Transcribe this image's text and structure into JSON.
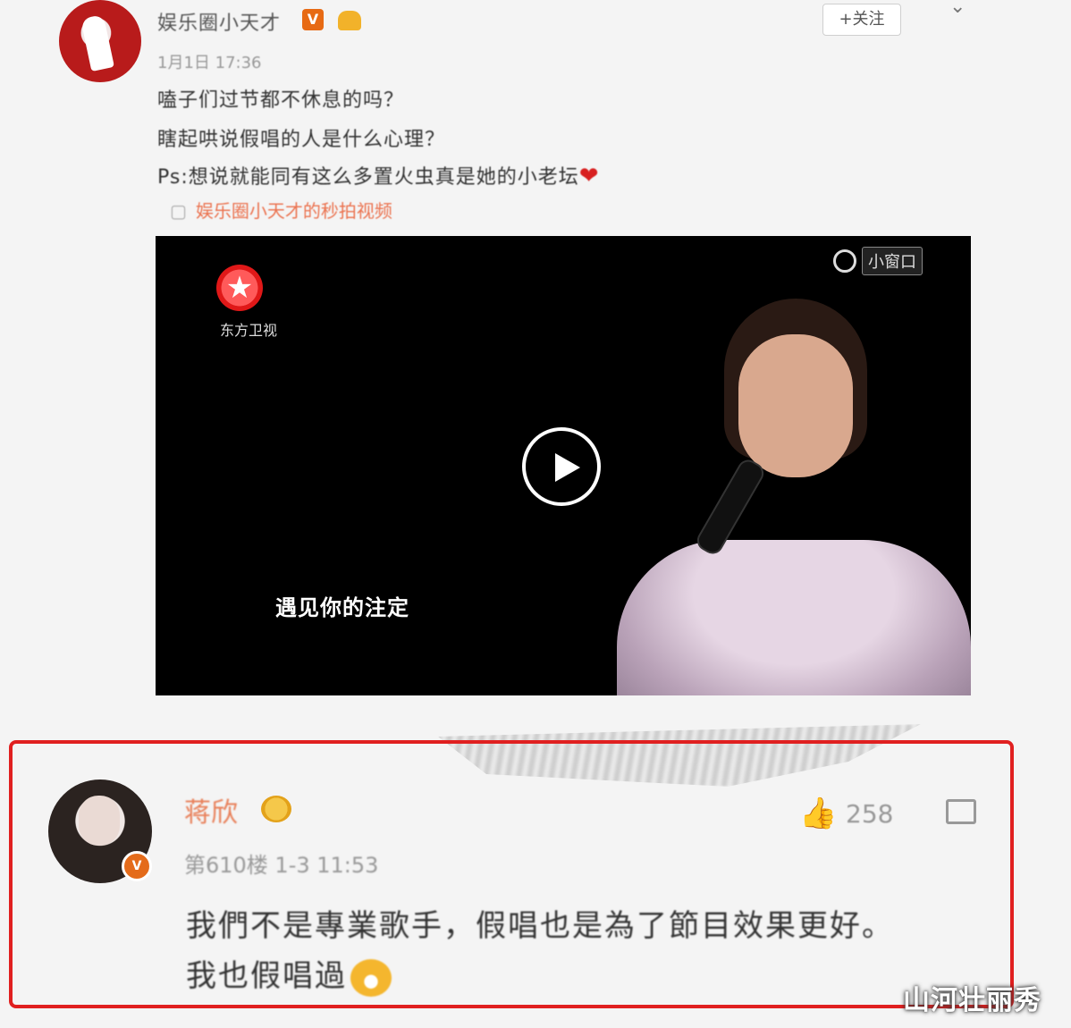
{
  "post": {
    "author": "娱乐圈小天才",
    "verified_badge": "V",
    "follow_label": "+关注",
    "chevron": "⌄",
    "time": "1月1日 17:36",
    "lines": [
      "嗑子们过节都不休息的吗？",
      "瞎起哄说假唱的人是什么心理？",
      "Ps:想说就能同有这么多置火虫真是她的小老坛"
    ],
    "heart": "❤",
    "link_icon": "▢",
    "link_text": "娱乐圈小天才的秒拍视频"
  },
  "video": {
    "channel_logo_glyph": "★",
    "channel_name": "东方卫视",
    "pip_label": "小窗口",
    "subtitle": "遇见你的注定"
  },
  "comment": {
    "name": "蒋欣",
    "vip_badge": "V",
    "like_icon": "👍",
    "likes": "258",
    "meta": "第610楼 1-3 11:53",
    "text_line1": "我們不是專業歌手，假唱也是為了節目效果更好。",
    "text_line2": "我也假唱過"
  },
  "watermark": "山河壮丽秀",
  "colors": {
    "highlight_border": "#e02020",
    "name_color": "#e8805a",
    "link_color": "#eb7350"
  }
}
